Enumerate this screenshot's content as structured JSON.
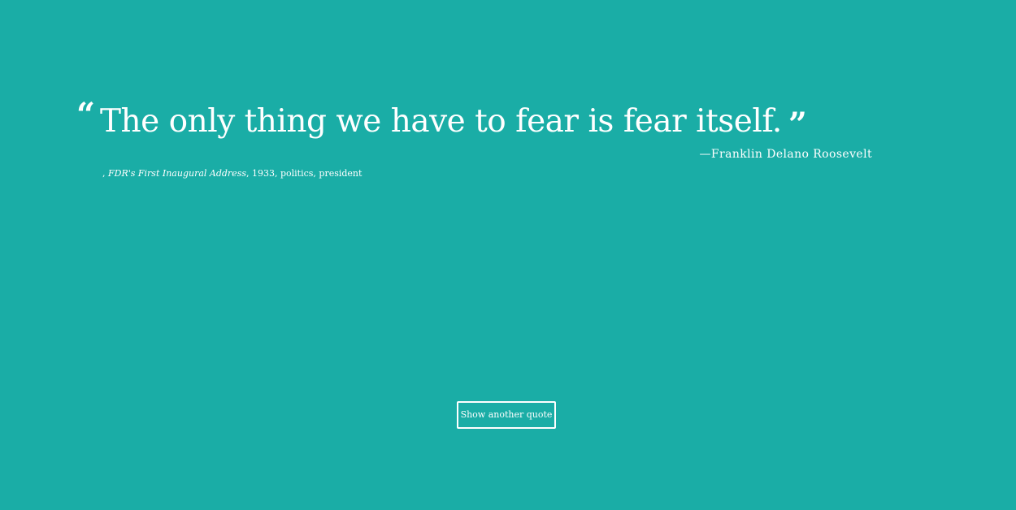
{
  "quote": {
    "open_mark": "“",
    "text": "The only thing we have to fear is fear itself.",
    "close_mark": "”",
    "author": "—Franklin Delano Roosevelt"
  },
  "meta": {
    "prefix": ", ",
    "source": "FDR's First Inaugural Address",
    "rest": ", 1933, politics, president"
  },
  "actions": {
    "show_another_label": "Show another quote"
  },
  "colors": {
    "background": "#1aada6",
    "foreground": "#ffffff"
  }
}
